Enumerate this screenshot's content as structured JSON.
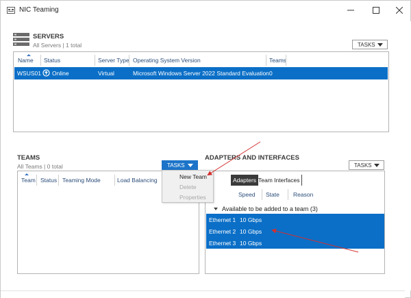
{
  "window": {
    "title": "NIC Teaming",
    "controls": {
      "minimize": "minimize",
      "maximize": "maximize",
      "close": "close"
    }
  },
  "servers": {
    "title": "SERVERS",
    "subtitle": "All Servers | 1 total",
    "tasks_label": "TASKS",
    "columns": [
      "Name",
      "Status",
      "Server Type",
      "Operating System Version",
      "Teams"
    ],
    "rows": [
      {
        "name": "WSUS01",
        "status": "Online",
        "server_type": "Virtual",
        "os": "Microsoft Windows Server 2022 Standard Evaluation",
        "teams": "0"
      }
    ]
  },
  "teams": {
    "title": "TEAMS",
    "subtitle": "All Teams | 0 total",
    "tasks_label": "TASKS",
    "columns": [
      "Team",
      "Status",
      "Teaming Mode",
      "Load Balancing"
    ],
    "menu": [
      {
        "label": "New Team",
        "enabled": true
      },
      {
        "label": "Delete",
        "enabled": false
      },
      {
        "label": "Properties",
        "enabled": false
      }
    ]
  },
  "adapters": {
    "title": "ADAPTERS AND INTERFACES",
    "tasks_label": "TASKS",
    "tabs": [
      {
        "label": "Adapters",
        "active": true
      },
      {
        "label": "Team Interfaces",
        "active": false
      }
    ],
    "columns": [
      "Speed",
      "State",
      "Reason"
    ],
    "group_label": "Available to be added to a team (3)",
    "rows": [
      {
        "name": "Ethernet 1",
        "speed": "10 Gbps"
      },
      {
        "name": "Ethernet 2",
        "speed": "10 Gbps"
      },
      {
        "name": "Ethernet 3",
        "speed": "10 Gbps"
      }
    ]
  },
  "colors": {
    "selection": "#0b6fc7",
    "tasks_active": "#1c74c9",
    "annotation_arrow": "#d32f2f",
    "header_text": "#2b4d7a"
  }
}
